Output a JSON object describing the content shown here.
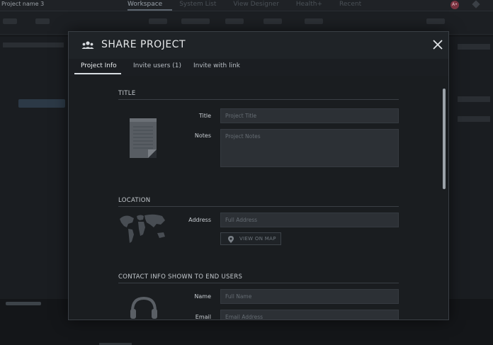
{
  "app": {
    "project_name": "Project name 3",
    "nav": [
      "Workspace",
      "System List",
      "View Designer",
      "Health+",
      "Recent"
    ],
    "active_nav": "Workspace",
    "avatar_initials": "A•"
  },
  "modal": {
    "title": "SHARE PROJECT",
    "tabs": [
      {
        "label": "Project Info",
        "active": true
      },
      {
        "label": "Invite users (1)",
        "active": false
      },
      {
        "label": "Invite with link",
        "active": false
      }
    ],
    "sections": {
      "title": {
        "heading": "TITLE",
        "title_label": "Title",
        "title_placeholder": "Project Title",
        "notes_label": "Notes",
        "notes_placeholder": "Project Notes"
      },
      "location": {
        "heading": "LOCATION",
        "address_label": "Address",
        "address_placeholder": "Full Address",
        "view_map_label": "VIEW ON MAP"
      },
      "contact": {
        "heading": "CONTACT INFO SHOWN TO END USERS",
        "name_label": "Name",
        "name_placeholder": "Full Name",
        "email_label": "Email",
        "email_placeholder": "Email Address"
      }
    }
  },
  "icons": {
    "header": "users-group-icon",
    "close": "close-icon",
    "notes": "notepad-icon",
    "map": "world-map-icon",
    "pin": "map-pin-icon",
    "contact": "headset-icon"
  },
  "colors": {
    "modal_bg": "#1f2327",
    "input_bg": "#2c3035",
    "text_primary": "#e6e8ea"
  }
}
